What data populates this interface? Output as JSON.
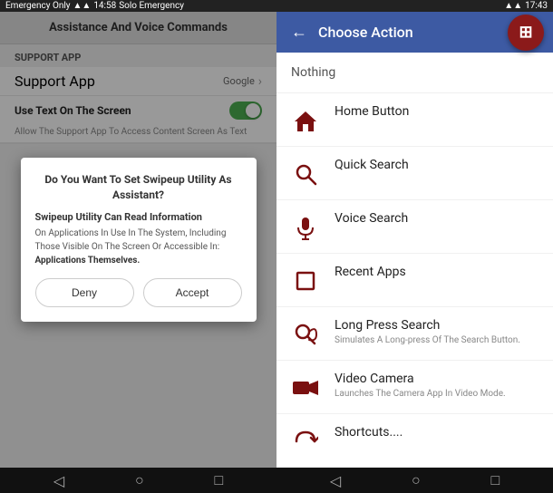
{
  "statusBar": {
    "leftText": "Emergency Only",
    "leftIcons": "📶",
    "leftTime": "14:58",
    "centerText": "Solo Emergency",
    "rightTime": "17:43",
    "rightIcons": "📶"
  },
  "leftPanel": {
    "header": "Assistance And Voice Commands",
    "sectionTitle": "Support App",
    "settingValue": "Google",
    "settingTitle": "Use Text On The Screen",
    "settingDesc": "Allow The Support App To Access Content Screen As Text"
  },
  "dialog": {
    "title": "Do You Want To Set Swipeup Utility As Assistant?",
    "subtitle": "Swipeup Utility Can Read Information",
    "body1": "On Applications In Use In The System, Including Those Visible On The Screen Or Accessible In:",
    "body2": "Applications Themselves.",
    "denyLabel": "Deny",
    "acceptLabel": "Accept"
  },
  "rightPanel": {
    "headerTitle": "Choose Action",
    "fabIcon": "+",
    "nothingLabel": "Nothing",
    "actions": [
      {
        "id": "home-button",
        "label": "Home Button",
        "desc": "",
        "icon": "home"
      },
      {
        "id": "quick-search",
        "label": "Quick Search",
        "desc": "",
        "icon": "search"
      },
      {
        "id": "voice-search",
        "label": "Voice Search",
        "desc": "",
        "icon": "mic"
      },
      {
        "id": "recent-apps",
        "label": "Recent Apps",
        "desc": "",
        "icon": "square"
      },
      {
        "id": "long-press-search",
        "label": "Long Press Search",
        "desc": "Simulates A Long-press Of The Search Button.",
        "icon": "search-loop"
      },
      {
        "id": "video-camera",
        "label": "Video Camera",
        "desc": "Launches The Camera App In Video Mode.",
        "icon": "video"
      },
      {
        "id": "shortcuts",
        "label": "Shortcuts....",
        "desc": "",
        "icon": "shortcuts"
      }
    ]
  },
  "bottomNav": {
    "leftButtons": [
      "◁",
      "○",
      "□"
    ],
    "rightButtons": [
      "◁",
      "○",
      "□"
    ]
  }
}
